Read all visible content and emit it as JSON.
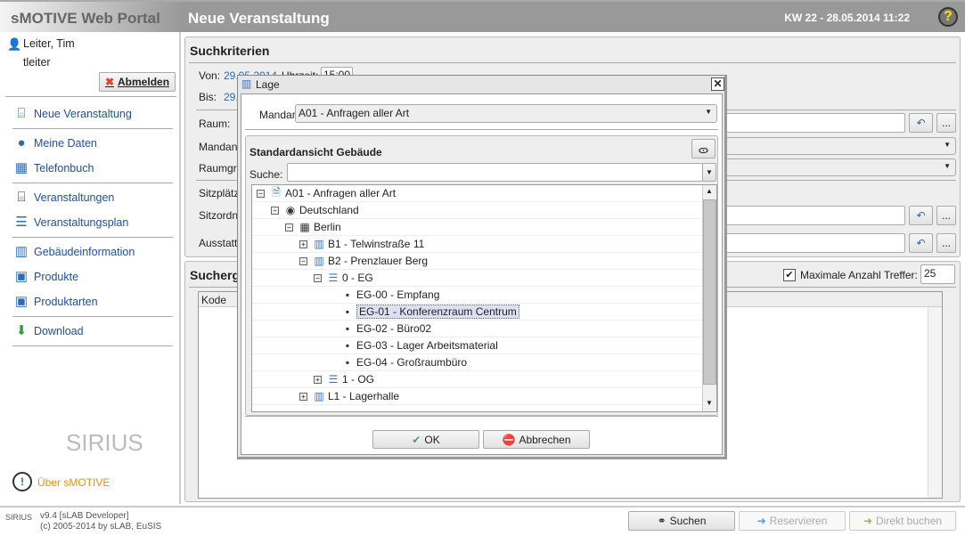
{
  "app": {
    "title": "sMOTIVE Web Portal",
    "page_title": "Neue Veranstaltung",
    "date": "KW 22 - 28.05.2014 11:22",
    "help_icon": "question-icon"
  },
  "user": {
    "name": "Leiter, Tim",
    "login": "tleiter",
    "logout": "Abmelden"
  },
  "sidebar": {
    "items": [
      {
        "label": "Neue Veranstaltung",
        "icon": "presentation-new-icon"
      },
      {
        "label": "Meine Daten",
        "icon": "user-icon"
      },
      {
        "label": "Telefonbuch",
        "icon": "phonebook-icon"
      },
      {
        "label": "Veranstaltungen",
        "icon": "presentation-icon"
      },
      {
        "label": "Veranstaltungsplan",
        "icon": "plan-icon"
      },
      {
        "label": "Gebäudeinformation",
        "icon": "building-icon"
      },
      {
        "label": "Produkte",
        "icon": "product-icon"
      },
      {
        "label": "Produktarten",
        "icon": "product-types-icon"
      },
      {
        "label": "Download",
        "icon": "download-icon"
      }
    ],
    "logo": "SIRIUS",
    "about": "Über sMOTIVE"
  },
  "criteria": {
    "title": "Suchkriterien",
    "von_label": "Von:",
    "von_date": "29.05.2014",
    "uhrzeit_label": "Uhrzeit:",
    "von_time": "15:00",
    "bis_label": "Bis:",
    "bis_date": "29.",
    "raum": "Raum:",
    "mandant": "Mandan",
    "raumgruppe": "Raumgr",
    "sitzplaetze": "Sitzplätz",
    "sitzordnung": "Sitzordn",
    "ausstattung": "Ausstatt",
    "more": "..."
  },
  "results": {
    "title": "Sucherg",
    "max_label": "Maximale Anzahl Treffer:",
    "max_value": "25",
    "max_checked": true,
    "col_kode": "Kode"
  },
  "dialog": {
    "title": "Lage",
    "mandant_label": "Mandant:",
    "mandant_value": "A01 - Anfragen aller Art",
    "view_title": "Standardansicht Gebäude",
    "search_label": "Suche:",
    "search_value": "",
    "tree": [
      {
        "label": "A01 - Anfragen aller Art",
        "level": 0,
        "toggle": "-",
        "icon": "document-icon"
      },
      {
        "label": "Deutschland",
        "level": 1,
        "toggle": "-",
        "icon": "globe-icon"
      },
      {
        "label": "Berlin",
        "level": 2,
        "toggle": "-",
        "icon": "city-icon"
      },
      {
        "label": "B1 - Telwinstraße 11",
        "level": 3,
        "toggle": "+",
        "icon": "building-icon"
      },
      {
        "label": "B2 - Prenzlauer Berg",
        "level": 3,
        "toggle": "-",
        "icon": "building-icon"
      },
      {
        "label": "0 - EG",
        "level": 4,
        "toggle": "-",
        "icon": "floor-icon"
      },
      {
        "label": "EG-00 - Empfang",
        "level": 5,
        "toggle": "",
        "icon": "room-icon"
      },
      {
        "label": "EG-01 - Konferenzraum Centrum",
        "level": 5,
        "toggle": "",
        "icon": "room-icon",
        "selected": true
      },
      {
        "label": "EG-02 - Büro02",
        "level": 5,
        "toggle": "",
        "icon": "room-icon"
      },
      {
        "label": "EG-03 - Lager Arbeitsmaterial",
        "level": 5,
        "toggle": "",
        "icon": "room-icon"
      },
      {
        "label": "EG-04 - Großraumbüro",
        "level": 5,
        "toggle": "",
        "icon": "room-icon"
      },
      {
        "label": "1 - OG",
        "level": 4,
        "toggle": "+",
        "icon": "floor-icon"
      },
      {
        "label": "L1 - Lagerhalle",
        "level": 3,
        "toggle": "+",
        "icon": "building-icon"
      }
    ],
    "ok": "OK",
    "cancel": "Abbrechen"
  },
  "footer": {
    "version": "v9.4 [sLAB Developer]",
    "copyright": "(c) 2005-2014 by sLAB, EuSIS",
    "search": "Suchen",
    "reserve": "Reservieren",
    "book": "Direkt buchen"
  }
}
